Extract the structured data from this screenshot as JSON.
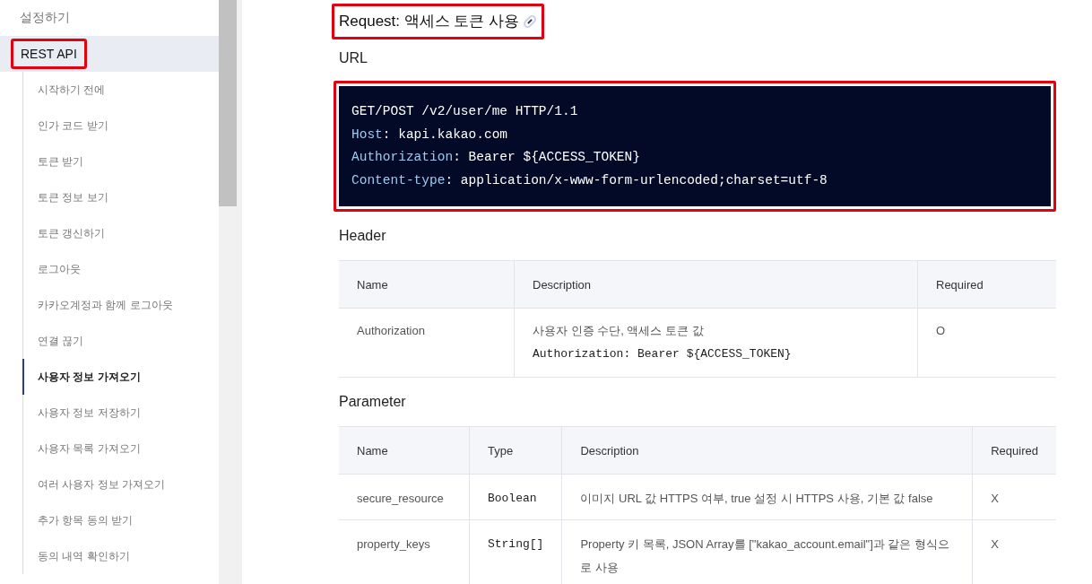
{
  "sidebar": {
    "items": [
      {
        "label": "설정하기",
        "kind": "top",
        "selected": false,
        "highlighted": false
      },
      {
        "label": "REST API",
        "kind": "section",
        "selected": true,
        "highlighted": true
      }
    ],
    "sub_items": [
      {
        "label": "시작하기 전에",
        "selected": false
      },
      {
        "label": "인가 코드 받기",
        "selected": false
      },
      {
        "label": "토큰 받기",
        "selected": false
      },
      {
        "label": "토큰 정보 보기",
        "selected": false
      },
      {
        "label": "토큰 갱신하기",
        "selected": false
      },
      {
        "label": "로그아웃",
        "selected": false
      },
      {
        "label": "카카오계정과 함께 로그아웃",
        "selected": false
      },
      {
        "label": "연결 끊기",
        "selected": false
      },
      {
        "label": "사용자 정보 가져오기",
        "selected": true
      },
      {
        "label": "사용자 정보 저장하기",
        "selected": false
      },
      {
        "label": "사용자 목록 가져오기",
        "selected": false
      },
      {
        "label": "여러 사용자 정보 가져오기",
        "selected": false
      },
      {
        "label": "추가 항목 동의 받기",
        "selected": false
      },
      {
        "label": "동의 내역 확인하기",
        "selected": false
      }
    ]
  },
  "content": {
    "title": {
      "text": "Request: 액세스 토큰 사용",
      "highlighted": true
    },
    "url_label": "URL",
    "code": {
      "highlighted": true,
      "lines": [
        {
          "text": "GET/POST /v2/user/me HTTP/1.1"
        },
        {
          "key": "Host",
          "text": ": kapi.kakao.com"
        },
        {
          "key": "Authorization",
          "text": ": Bearer ${ACCESS_TOKEN}"
        },
        {
          "key": "Content-type",
          "text": ": application/x-www-form-urlencoded;charset=utf-8"
        }
      ]
    },
    "header_label": "Header",
    "header_table": {
      "columns": [
        "Name",
        "Description",
        "Required"
      ],
      "rows": [
        [
          {
            "lines": [
              {
                "kind": "text",
                "text": "Authorization"
              }
            ]
          },
          {
            "lines": [
              {
                "kind": "text",
                "text": "사용자 인증 수단, 액세스 토큰 값"
              },
              {
                "kind": "code",
                "text": "Authorization: Bearer ${ACCESS_TOKEN}"
              }
            ]
          },
          {
            "lines": [
              {
                "kind": "text",
                "text": "O"
              }
            ]
          }
        ]
      ]
    },
    "parameter_label": "Parameter",
    "parameter_table": {
      "columns": [
        "Name",
        "Type",
        "Description",
        "Required"
      ],
      "rows": [
        [
          {
            "lines": [
              {
                "kind": "text",
                "text": "secure_resource"
              }
            ]
          },
          {
            "lines": [
              {
                "kind": "code",
                "text": "Boolean"
              }
            ]
          },
          {
            "lines": [
              {
                "kind": "text",
                "text": "이미지 URL 값 HTTPS 여부, true 설정 시 HTTPS 사용, 기본 값 false"
              }
            ]
          },
          {
            "lines": [
              {
                "kind": "text",
                "text": "X"
              }
            ]
          }
        ],
        [
          {
            "lines": [
              {
                "kind": "text",
                "text": "property_keys"
              }
            ]
          },
          {
            "lines": [
              {
                "kind": "code",
                "text": "String[]"
              }
            ]
          },
          {
            "lines": [
              {
                "kind": "text",
                "text": "Property 키 목록, JSON Array를 [\"kakao_account.email\"]과 같은 형식으로 사용"
              }
            ]
          },
          {
            "lines": [
              {
                "kind": "text",
                "text": "X"
              }
            ]
          }
        ]
      ]
    }
  }
}
